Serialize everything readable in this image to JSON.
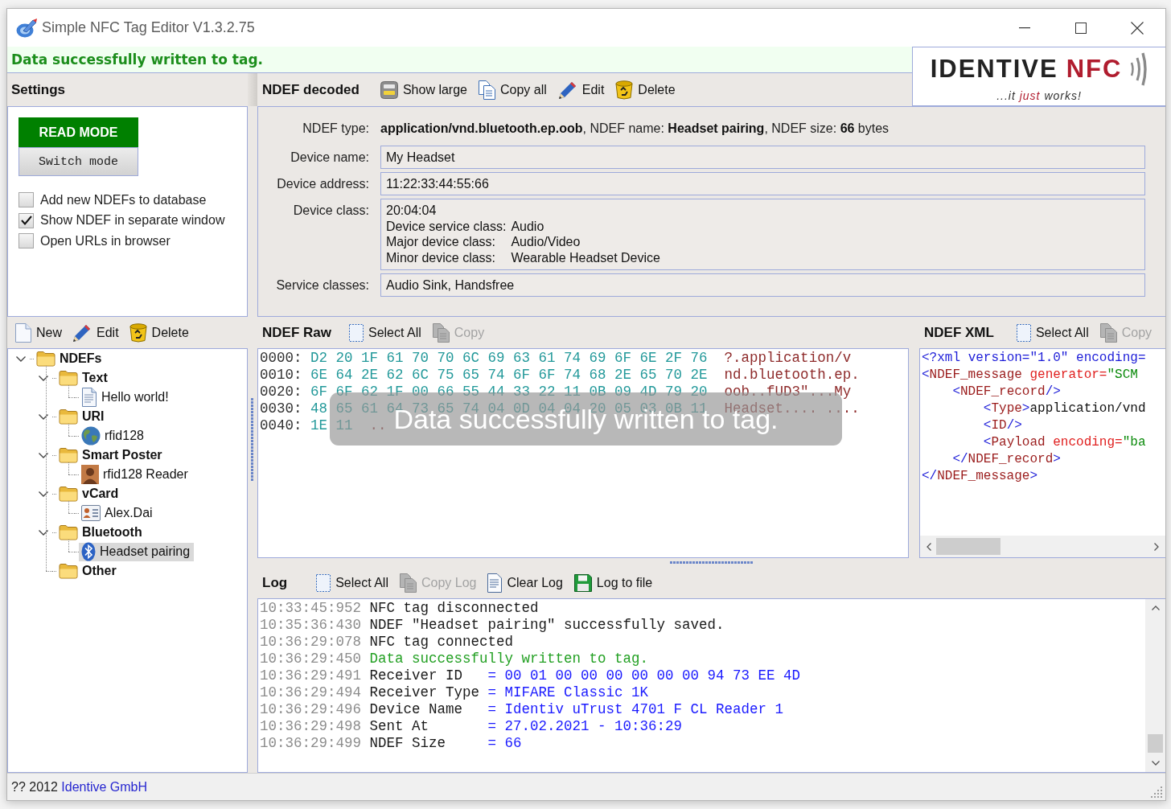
{
  "window": {
    "title": "Simple NFC Tag Editor V1.3.2.75"
  },
  "banner": {
    "message": "Data successfully written to tag."
  },
  "logo": {
    "wordmark": "IDENTIVE",
    "product": "NFC",
    "tagline": "...it *just* works!"
  },
  "settings": {
    "title": "Settings",
    "mode": {
      "label": "READ MODE",
      "button": "Switch mode"
    },
    "options": [
      {
        "label": "Add new NDEFs to database",
        "checked": false
      },
      {
        "label": "Show NDEF in separate window",
        "checked": true
      },
      {
        "label": "Open URLs in browser",
        "checked": false
      }
    ]
  },
  "tree_toolbar": [
    {
      "kind": "new",
      "label": "New",
      "disabled": false
    },
    {
      "kind": "edit",
      "label": "Edit",
      "disabled": false
    },
    {
      "kind": "delete",
      "label": "Delete",
      "disabled": false
    }
  ],
  "tree": {
    "items": [
      {
        "label": "NDEFs",
        "kind": "folder",
        "expanded": true,
        "selected": false,
        "children": [
          {
            "label": "Text",
            "kind": "folder",
            "expanded": true,
            "selected": false,
            "children": [
              {
                "label": "Hello world!",
                "kind": "text",
                "selected": false
              }
            ]
          },
          {
            "label": "URI",
            "kind": "folder",
            "expanded": true,
            "selected": false,
            "children": [
              {
                "label": "rfid128",
                "kind": "uri",
                "selected": false
              }
            ]
          },
          {
            "label": "Smart Poster",
            "kind": "folder",
            "expanded": true,
            "selected": false,
            "children": [
              {
                "label": "rfid128 Reader",
                "kind": "poster",
                "selected": false
              }
            ]
          },
          {
            "label": "vCard",
            "kind": "folder",
            "expanded": true,
            "selected": false,
            "children": [
              {
                "label": "Alex.Dai",
                "kind": "vcard",
                "selected": false
              }
            ]
          },
          {
            "label": "Bluetooth",
            "kind": "folder",
            "expanded": true,
            "selected": false,
            "children": [
              {
                "label": "Headset pairing",
                "kind": "bluetooth",
                "selected": true
              }
            ]
          },
          {
            "label": "Other",
            "kind": "folder",
            "expanded": false,
            "selected": false
          }
        ]
      }
    ]
  },
  "decoded": {
    "title": "NDEF decoded",
    "toolbar": [
      {
        "kind": "show",
        "label": "Show large",
        "disabled": false
      },
      {
        "kind": "copy",
        "label": "Copy all",
        "disabled": false
      },
      {
        "kind": "edit",
        "label": "Edit",
        "disabled": false
      },
      {
        "kind": "delete",
        "label": "Delete",
        "disabled": false
      }
    ],
    "summary_label": "NDEF type:",
    "summary": "**application/vnd.bluetooth.ep.oob**, NDEF name: **Headset pairing**, NDEF size: **66** bytes",
    "fields": [
      {
        "kind": "line",
        "label": "Device name:",
        "value": "My Headset"
      },
      {
        "kind": "line",
        "label": "Device address:",
        "value": "11:22:33:44:55:66"
      },
      {
        "kind": "multi",
        "label": "Device class:",
        "value": "20:04:04",
        "details": [
          {
            "label": "Device service class:",
            "value": "Audio"
          },
          {
            "label": "Major device class:",
            "value": "Audio/Video"
          },
          {
            "label": "Minor device class:",
            "value": "Wearable Headset Device"
          }
        ]
      },
      {
        "kind": "line",
        "label": "Service classes:",
        "value": "Audio Sink, Handsfree"
      }
    ]
  },
  "raw": {
    "title": "NDEF Raw",
    "toolbar": [
      {
        "kind": "select",
        "label": "Select All",
        "disabled": false
      },
      {
        "kind": "copy",
        "label": "Copy",
        "disabled": true
      }
    ],
    "rows": [
      {
        "offset": "0000:",
        "bytes": "D2 20 1F 61 70 70 6C 69 63 61 74 69 6F 6E 2F 76",
        "ascii": "?.application/v"
      },
      {
        "offset": "0010:",
        "bytes": "6E 64 2E 62 6C 75 65 74 6F 6F 74 68 2E 65 70 2E",
        "ascii": "nd.bluetooth.ep."
      },
      {
        "offset": "0020:",
        "bytes": "6F 6F 62 1F 00 66 55 44 33 22 11 0B 09 4D 79 20",
        "ascii": "oob..fUD3\"...My"
      },
      {
        "offset": "0030:",
        "bytes": "48 65 61 64 73 65 74 04 0D 04 04 20 05 03 0B 11",
        "ascii": "Headset.... ...."
      },
      {
        "offset": "0040:",
        "bytes": "1E 11",
        "ascii": ".."
      }
    ],
    "toast": "Data successfully written to tag."
  },
  "xml": {
    "title": "NDEF XML",
    "toolbar": [
      {
        "kind": "select",
        "label": "Select All",
        "disabled": false
      },
      {
        "kind": "copy",
        "label": "Copy",
        "disabled": true
      }
    ],
    "lines": [
      "<?xml version=\"1.0\" encoding=",
      "<NDEF_message generator=\"SCM",
      "    <NDEF_record/>",
      "        <Type>application/vnd",
      "        <ID/>",
      "        <Payload encoding=\"ba",
      "    </NDEF_record>",
      "</NDEF_message>"
    ]
  },
  "log": {
    "title": "Log",
    "toolbar": [
      {
        "kind": "select",
        "label": "Select All",
        "disabled": false
      },
      {
        "kind": "copy",
        "label": "Copy Log",
        "disabled": true
      },
      {
        "kind": "clear",
        "label": "Clear Log",
        "disabled": false
      },
      {
        "kind": "save",
        "label": "Log to file",
        "disabled": false
      }
    ],
    "entries": [
      {
        "time": "10:33:45:952",
        "kind": "plain",
        "message": "NFC tag disconnected"
      },
      {
        "time": "10:35:36:430",
        "kind": "plain",
        "message": "NDEF \"Headset pairing\" successfully saved."
      },
      {
        "time": "10:36:29:078",
        "kind": "plain",
        "message": "NFC tag connected"
      },
      {
        "time": "10:36:29:450",
        "kind": "success",
        "message": "Data successfully written to tag."
      },
      {
        "time": "10:36:29:491",
        "kind": "field",
        "label": "Receiver ID",
        "value": "= 00 01 00 00 00 00 00 00 94 73 EE 4D"
      },
      {
        "time": "10:36:29:494",
        "kind": "field",
        "label": "Receiver Type",
        "value": "= MIFARE Classic 1K"
      },
      {
        "time": "10:36:29:496",
        "kind": "field",
        "label": "Device Name",
        "value": "= Identiv uTrust 4701 F CL Reader 1"
      },
      {
        "time": "10:36:29:498",
        "kind": "field",
        "label": "Sent At",
        "value": "= 27.02.2021 - 10:36:29"
      },
      {
        "time": "10:36:29:499",
        "kind": "field",
        "label": "NDEF Size",
        "value": "= 66"
      }
    ]
  },
  "status_bar": {
    "copyright": "?? 2012",
    "link": "Identive GmbH"
  }
}
